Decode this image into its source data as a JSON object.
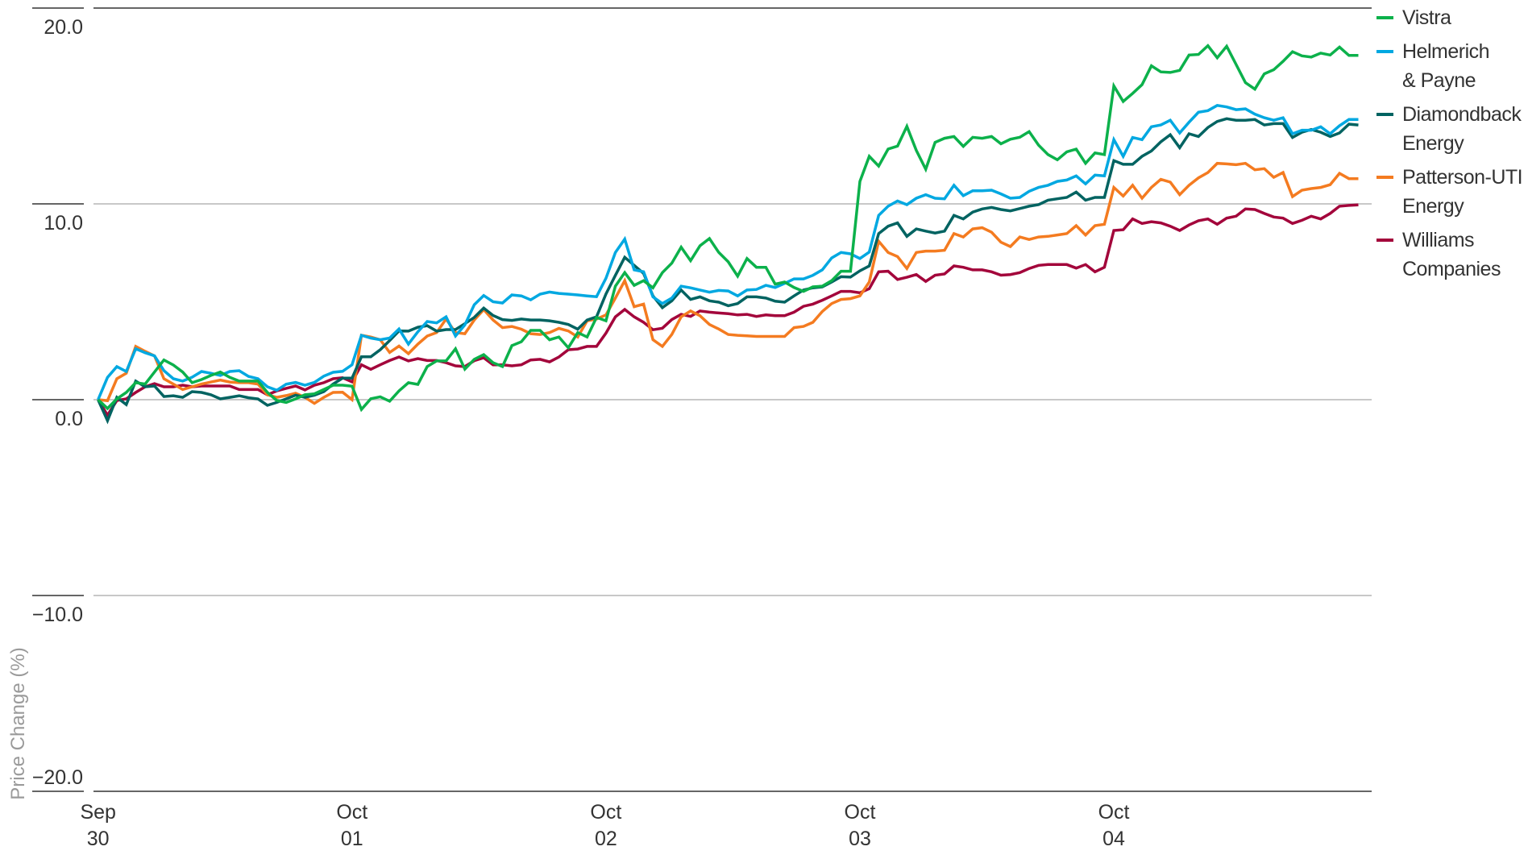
{
  "chart_data": {
    "type": "line",
    "title": "",
    "xlabel": "",
    "ylabel": "Price Change (%)",
    "ylim": [
      -20,
      20
    ],
    "yticks": [
      20,
      10,
      0,
      -10,
      -20
    ],
    "ytick_labels": [
      "20.0",
      "10.0",
      "0.0",
      "−10.0",
      "−20.0"
    ],
    "x_count": 135,
    "xticks": [
      {
        "index": 0,
        "line1": "Sep",
        "line2": "30"
      },
      {
        "index": 27,
        "line1": "Oct",
        "line2": "01"
      },
      {
        "index": 54,
        "line1": "Oct",
        "line2": "02"
      },
      {
        "index": 81,
        "line1": "Oct",
        "line2": "03"
      },
      {
        "index": 108,
        "line1": "Oct",
        "line2": "04"
      }
    ],
    "grid": true,
    "legend_position": "right",
    "series": [
      {
        "name": "Vistra",
        "legend_lines": [
          "Vistra"
        ],
        "color": "#0cb14b",
        "values": [
          0,
          -0.45,
          0.04,
          0.37,
          0.87,
          0.8,
          1.41,
          2.03,
          1.77,
          1.41,
          0.87,
          1.03,
          1.24,
          1.41,
          1.14,
          0.95,
          0.95,
          0.95,
          0.37,
          -0.04,
          -0.14,
          0.04,
          0.25,
          0.3,
          0.52,
          0.74,
          0.74,
          0.69,
          -0.5,
          0.05,
          0.15,
          -0.08,
          0.45,
          0.87,
          0.78,
          1.69,
          1.98,
          1.98,
          2.6,
          1.56,
          2.06,
          2.3,
          1.89,
          1.69,
          2.76,
          2.96,
          3.54,
          3.54,
          3.06,
          3.2,
          2.65,
          3.43,
          3.2,
          4.2,
          4.03,
          5.8,
          6.49,
          5.84,
          6.08,
          5.71,
          6.49,
          6.97,
          7.79,
          7.1,
          7.86,
          8.23,
          7.52,
          7.04,
          6.31,
          7.21,
          6.76,
          6.76,
          5.9,
          6.01,
          5.73,
          5.53,
          5.76,
          5.8,
          6.08,
          6.56,
          6.56,
          11.15,
          12.43,
          11.93,
          12.8,
          12.95,
          13.96,
          12.73,
          11.77,
          13.14,
          13.35,
          13.44,
          12.94,
          13.4,
          13.35,
          13.44,
          13.07,
          13.3,
          13.4,
          13.69,
          13.0,
          12.52,
          12.25,
          12.66,
          12.8,
          12.07,
          12.6,
          12.52,
          16.02,
          15.23,
          15.64,
          16.09,
          17.05,
          16.74,
          16.71,
          16.82,
          17.6,
          17.63,
          18.08,
          17.46,
          18.05,
          17.12,
          16.19,
          15.86,
          16.64,
          16.85,
          17.28,
          17.77,
          17.56,
          17.5,
          17.7,
          17.6,
          18.01,
          17.58,
          17.58
        ]
      },
      {
        "name": "Helmerich & Payne",
        "legend_lines": [
          "Helmerich",
          "& Payne"
        ],
        "color": "#00a8e1",
        "values": [
          0,
          1.14,
          1.69,
          1.44,
          2.6,
          2.4,
          2.24,
          1.48,
          1.07,
          0.95,
          1.15,
          1.44,
          1.35,
          1.24,
          1.44,
          1.48,
          1.19,
          1.07,
          0.66,
          0.48,
          0.79,
          0.88,
          0.74,
          0.88,
          1.2,
          1.4,
          1.45,
          1.78,
          3.29,
          3.15,
          3.06,
          3.15,
          3.61,
          2.84,
          3.47,
          3.99,
          3.92,
          4.23,
          3.25,
          3.82,
          4.85,
          5.32,
          5.0,
          4.94,
          5.35,
          5.3,
          5.1,
          5.39,
          5.5,
          5.43,
          5.39,
          5.35,
          5.3,
          5.26,
          6.2,
          7.52,
          8.2,
          6.63,
          6.53,
          5.25,
          4.91,
          5.19,
          5.8,
          5.71,
          5.6,
          5.49,
          5.58,
          5.55,
          5.3,
          5.6,
          5.63,
          5.84,
          5.73,
          5.94,
          6.17,
          6.17,
          6.35,
          6.63,
          7.24,
          7.52,
          7.45,
          7.21,
          7.54,
          9.41,
          9.88,
          10.15,
          9.96,
          10.29,
          10.47,
          10.29,
          10.26,
          10.95,
          10.42,
          10.67,
          10.67,
          10.7,
          10.51,
          10.29,
          10.33,
          10.64,
          10.84,
          10.95,
          11.15,
          11.22,
          11.43,
          11.02,
          11.47,
          11.43,
          13.28,
          12.43,
          13.39,
          13.28,
          13.94,
          14.03,
          14.27,
          13.62,
          14.17,
          14.68,
          14.76,
          15.03,
          14.95,
          14.81,
          14.85,
          14.58,
          14.4,
          14.27,
          14.4,
          13.58,
          13.76,
          13.76,
          13.94,
          13.58,
          13.99,
          14.31,
          14.31
        ]
      },
      {
        "name": "Diamondback Energy",
        "legend_lines": [
          "Diamondback",
          "Energy"
        ],
        "color": "#006361",
        "values": [
          0,
          -1.07,
          0.12,
          -0.25,
          0.95,
          0.66,
          0.7,
          0.16,
          0.2,
          0.12,
          0.41,
          0.37,
          0.25,
          0.04,
          0.12,
          0.2,
          0.1,
          0.04,
          -0.29,
          -0.14,
          0.04,
          0.23,
          0.12,
          0.23,
          0.41,
          0.8,
          1.1,
          1.1,
          2.19,
          2.19,
          2.55,
          3.02,
          3.51,
          3.5,
          3.7,
          3.78,
          3.5,
          3.58,
          3.58,
          3.88,
          4.2,
          4.68,
          4.3,
          4.09,
          4.05,
          4.12,
          4.07,
          4.07,
          4.03,
          3.95,
          3.84,
          3.6,
          4.07,
          4.23,
          5.4,
          6.35,
          7.27,
          6.86,
          6.45,
          5.3,
          4.7,
          5.05,
          5.6,
          5.12,
          5.25,
          5.05,
          4.98,
          4.8,
          4.91,
          5.25,
          5.25,
          5.19,
          5.03,
          4.98,
          5.3,
          5.6,
          5.71,
          5.76,
          6.01,
          6.28,
          6.26,
          6.58,
          6.83,
          8.48,
          8.86,
          9.03,
          8.34,
          8.72,
          8.61,
          8.51,
          8.61,
          9.41,
          9.23,
          9.58,
          9.74,
          9.82,
          9.71,
          9.64,
          9.76,
          9.88,
          9.96,
          10.19,
          10.26,
          10.33,
          10.6,
          10.19,
          10.33,
          10.33,
          12.21,
          12.02,
          12.02,
          12.43,
          12.7,
          13.17,
          13.53,
          12.87,
          13.58,
          13.44,
          13.9,
          14.21,
          14.35,
          14.27,
          14.27,
          14.31,
          14.03,
          14.1,
          14.1,
          13.39,
          13.66,
          13.8,
          13.66,
          13.44,
          13.62,
          14.07,
          14.03
        ]
      },
      {
        "name": "Patterson-UTI Energy",
        "legend_lines": [
          "Patterson-UTI",
          "Energy"
        ],
        "color": "#f47b20",
        "values": [
          0,
          -0.05,
          1.07,
          1.35,
          2.72,
          2.47,
          2.24,
          1.07,
          0.8,
          0.52,
          0.66,
          0.8,
          0.9,
          1.0,
          0.9,
          0.87,
          0.87,
          0.8,
          0.25,
          0.12,
          0.21,
          0.33,
          0.12,
          -0.19,
          0.12,
          0.37,
          0.38,
          0.0,
          3.29,
          3.2,
          3.06,
          2.41,
          2.74,
          2.35,
          2.84,
          3.25,
          3.43,
          4.12,
          3.43,
          3.37,
          4.07,
          4.6,
          4.07,
          3.68,
          3.74,
          3.6,
          3.37,
          3.33,
          3.43,
          3.64,
          3.51,
          3.2,
          4.03,
          4.12,
          4.33,
          5.19,
          6.08,
          4.75,
          4.88,
          3.06,
          2.72,
          3.33,
          4.23,
          4.53,
          4.29,
          3.84,
          3.61,
          3.33,
          3.29,
          3.26,
          3.23,
          3.23,
          3.23,
          3.23,
          3.68,
          3.74,
          3.95,
          4.5,
          4.91,
          5.12,
          5.16,
          5.3,
          6.01,
          8.09,
          7.52,
          7.31,
          6.7,
          7.52,
          7.59,
          7.59,
          7.63,
          8.48,
          8.31,
          8.72,
          8.78,
          8.55,
          8.04,
          7.82,
          8.31,
          8.18,
          8.31,
          8.34,
          8.41,
          8.48,
          8.89,
          8.41,
          8.89,
          8.96,
          10.84,
          10.4,
          10.95,
          10.29,
          10.84,
          11.25,
          11.11,
          10.47,
          10.95,
          11.33,
          11.6,
          12.07,
          12.04,
          12.0,
          12.07,
          11.74,
          11.8,
          11.36,
          11.6,
          10.37,
          10.7,
          10.78,
          10.84,
          10.98,
          11.56,
          11.29,
          11.29
        ]
      },
      {
        "name": "Williams Companies",
        "legend_lines": [
          "Williams",
          "Companies"
        ],
        "color": "#a3053b",
        "values": [
          0,
          -0.79,
          -0.04,
          0.04,
          0.37,
          0.66,
          0.82,
          0.66,
          0.66,
          0.74,
          0.66,
          0.7,
          0.7,
          0.7,
          0.7,
          0.52,
          0.52,
          0.52,
          0.25,
          0.45,
          0.58,
          0.7,
          0.5,
          0.74,
          0.87,
          1.07,
          1.12,
          0.91,
          1.78,
          1.55,
          1.78,
          2.0,
          2.18,
          1.98,
          2.1,
          2.0,
          2.0,
          1.89,
          1.73,
          1.69,
          1.99,
          2.14,
          1.78,
          1.78,
          1.73,
          1.78,
          2.03,
          2.06,
          1.93,
          2.18,
          2.55,
          2.59,
          2.72,
          2.72,
          3.4,
          4.23,
          4.61,
          4.23,
          3.95,
          3.57,
          3.65,
          4.09,
          4.36,
          4.25,
          4.53,
          4.47,
          4.43,
          4.39,
          4.33,
          4.36,
          4.25,
          4.33,
          4.29,
          4.29,
          4.47,
          4.77,
          4.88,
          5.08,
          5.3,
          5.53,
          5.53,
          5.46,
          5.67,
          6.53,
          6.56,
          6.14,
          6.25,
          6.39,
          6.04,
          6.36,
          6.42,
          6.83,
          6.76,
          6.63,
          6.63,
          6.53,
          6.36,
          6.39,
          6.49,
          6.7,
          6.86,
          6.9,
          6.9,
          6.9,
          6.72,
          6.9,
          6.53,
          6.76,
          8.64,
          8.68,
          9.23,
          9.0,
          9.09,
          9.03,
          8.86,
          8.64,
          8.92,
          9.14,
          9.23,
          8.96,
          9.27,
          9.37,
          9.74,
          9.71,
          9.51,
          9.33,
          9.27,
          9.0,
          9.16,
          9.37,
          9.23,
          9.51,
          9.88,
          9.92,
          9.95
        ]
      }
    ]
  }
}
